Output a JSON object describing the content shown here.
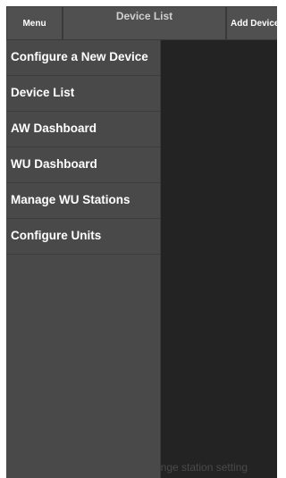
{
  "topbar": {
    "menu_label": "Menu",
    "title": "Device List",
    "add_label": "Add Device"
  },
  "drawer": {
    "items": [
      {
        "label": "Configure a New Device"
      },
      {
        "label": "Device List"
      },
      {
        "label": "AW Dashboard"
      },
      {
        "label": "WU Dashboard"
      },
      {
        "label": "Manage WU Stations"
      },
      {
        "label": "Configure Units"
      }
    ]
  },
  "background": {
    "hint_text": "ange station setting"
  }
}
